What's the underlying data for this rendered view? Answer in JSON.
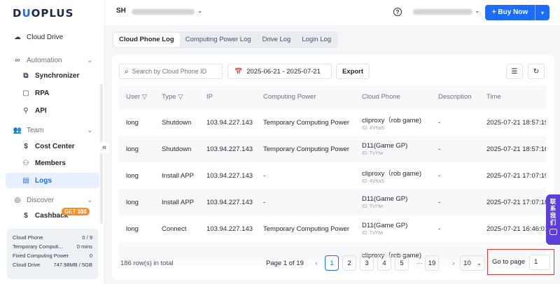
{
  "brand": {
    "logo_text_a": "D",
    "logo_text_u": "U",
    "logo_text_b": "OPLUS"
  },
  "sidebar": {
    "cloud_drive": "Cloud Drive",
    "automation": "Automation",
    "synchronizer": "Synchronizer",
    "rpa": "RPA",
    "api": "API",
    "team": "Team",
    "cost_center": "Cost Center",
    "members": "Members",
    "logs": "Logs",
    "discover": "Discover",
    "cashback": "Cashback",
    "cashback_badge": "GET $$$"
  },
  "stats": [
    {
      "label": "Cloud Phone",
      "value": "0 / 9"
    },
    {
      "label": "Temporary Computi...",
      "value": "0 mins"
    },
    {
      "label": "Fixed Computing Power",
      "value": "0"
    },
    {
      "label": "Cloud Drive",
      "value": "747.98MB / 5GB"
    }
  ],
  "header": {
    "avatar": "SH",
    "buy_label": "+ Buy Now"
  },
  "tabs": [
    "Cloud Phone Log",
    "Computing Power Log",
    "Drive Log",
    "Login Log"
  ],
  "toolbar": {
    "search_placeholder": "Search by Cloud Phone ID",
    "date_range": "2025-06-21 - 2025-07-21",
    "export_label": "Export"
  },
  "table": {
    "headers": [
      "User",
      "Type",
      "IP",
      "Computing Power",
      "Cloud Phone",
      "Description",
      "Time"
    ],
    "rows": [
      {
        "user": "long",
        "type": "Shutdown",
        "ip": "103.94.227.143",
        "power": "Temporary Computing Power",
        "phone": "cliproxy（rob game)",
        "phone_id": "ID: 4VhaS",
        "desc": "-",
        "time": "2025-07-21 18:57:19"
      },
      {
        "user": "long",
        "type": "Shutdown",
        "ip": "103.94.227.143",
        "power": "Temporary Computing Power",
        "phone": "D11(Game GP)",
        "phone_id": "ID: TvYtw",
        "desc": "-",
        "time": "2025-07-21 18:57:16"
      },
      {
        "user": "long",
        "type": "Install APP",
        "ip": "103.94.227.143",
        "power": "-",
        "phone": "cliproxy（rob game)",
        "phone_id": "ID: 4VhaS",
        "desc": "-",
        "time": "2025-07-21 17:07:19"
      },
      {
        "user": "long",
        "type": "Install APP",
        "ip": "103.94.227.143",
        "power": "-",
        "phone": "D11(Game GP)",
        "phone_id": "ID: TvYtw",
        "desc": "-",
        "time": "2025-07-21 17:07:18"
      },
      {
        "user": "long",
        "type": "Connect",
        "ip": "103.94.227.143",
        "power": "Temporary Computing Power",
        "phone": "D11(Game GP)",
        "phone_id": "ID: TvYtw",
        "desc": "-",
        "time": "2025-07-21 16:46:01"
      },
      {
        "user": "",
        "type": "",
        "ip": "",
        "power": "",
        "phone": "cliproxy（rob game)",
        "phone_id": "",
        "desc": "",
        "time": ""
      }
    ]
  },
  "pagination": {
    "total": "186 row(s) in total",
    "page_of": "Page 1 of 19",
    "pages": [
      "1",
      "2",
      "3",
      "4",
      "5",
      "···",
      "19"
    ],
    "page_size": "10",
    "goto_label": "Go to page",
    "goto_value": "1"
  },
  "contact": {
    "text": [
      "联",
      "系",
      "我",
      "们"
    ]
  }
}
